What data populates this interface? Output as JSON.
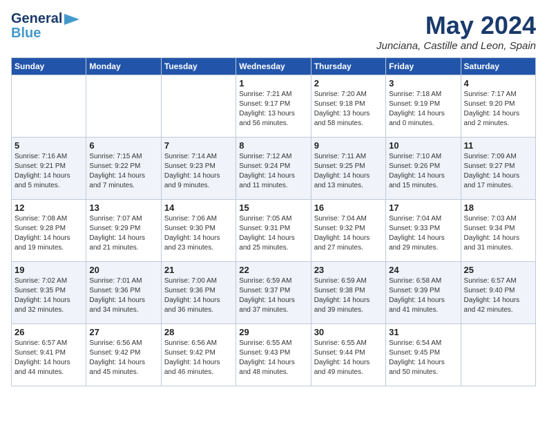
{
  "header": {
    "logo_general": "General",
    "logo_blue": "Blue",
    "month": "May 2024",
    "location": "Junciana, Castille and Leon, Spain"
  },
  "days_of_week": [
    "Sunday",
    "Monday",
    "Tuesday",
    "Wednesday",
    "Thursday",
    "Friday",
    "Saturday"
  ],
  "weeks": [
    {
      "days": [
        {
          "num": "",
          "info": ""
        },
        {
          "num": "",
          "info": ""
        },
        {
          "num": "",
          "info": ""
        },
        {
          "num": "1",
          "info": "Sunrise: 7:21 AM\nSunset: 9:17 PM\nDaylight: 13 hours\nand 56 minutes."
        },
        {
          "num": "2",
          "info": "Sunrise: 7:20 AM\nSunset: 9:18 PM\nDaylight: 13 hours\nand 58 minutes."
        },
        {
          "num": "3",
          "info": "Sunrise: 7:18 AM\nSunset: 9:19 PM\nDaylight: 14 hours\nand 0 minutes."
        },
        {
          "num": "4",
          "info": "Sunrise: 7:17 AM\nSunset: 9:20 PM\nDaylight: 14 hours\nand 2 minutes."
        }
      ]
    },
    {
      "days": [
        {
          "num": "5",
          "info": "Sunrise: 7:16 AM\nSunset: 9:21 PM\nDaylight: 14 hours\nand 5 minutes."
        },
        {
          "num": "6",
          "info": "Sunrise: 7:15 AM\nSunset: 9:22 PM\nDaylight: 14 hours\nand 7 minutes."
        },
        {
          "num": "7",
          "info": "Sunrise: 7:14 AM\nSunset: 9:23 PM\nDaylight: 14 hours\nand 9 minutes."
        },
        {
          "num": "8",
          "info": "Sunrise: 7:12 AM\nSunset: 9:24 PM\nDaylight: 14 hours\nand 11 minutes."
        },
        {
          "num": "9",
          "info": "Sunrise: 7:11 AM\nSunset: 9:25 PM\nDaylight: 14 hours\nand 13 minutes."
        },
        {
          "num": "10",
          "info": "Sunrise: 7:10 AM\nSunset: 9:26 PM\nDaylight: 14 hours\nand 15 minutes."
        },
        {
          "num": "11",
          "info": "Sunrise: 7:09 AM\nSunset: 9:27 PM\nDaylight: 14 hours\nand 17 minutes."
        }
      ]
    },
    {
      "days": [
        {
          "num": "12",
          "info": "Sunrise: 7:08 AM\nSunset: 9:28 PM\nDaylight: 14 hours\nand 19 minutes."
        },
        {
          "num": "13",
          "info": "Sunrise: 7:07 AM\nSunset: 9:29 PM\nDaylight: 14 hours\nand 21 minutes."
        },
        {
          "num": "14",
          "info": "Sunrise: 7:06 AM\nSunset: 9:30 PM\nDaylight: 14 hours\nand 23 minutes."
        },
        {
          "num": "15",
          "info": "Sunrise: 7:05 AM\nSunset: 9:31 PM\nDaylight: 14 hours\nand 25 minutes."
        },
        {
          "num": "16",
          "info": "Sunrise: 7:04 AM\nSunset: 9:32 PM\nDaylight: 14 hours\nand 27 minutes."
        },
        {
          "num": "17",
          "info": "Sunrise: 7:04 AM\nSunset: 9:33 PM\nDaylight: 14 hours\nand 29 minutes."
        },
        {
          "num": "18",
          "info": "Sunrise: 7:03 AM\nSunset: 9:34 PM\nDaylight: 14 hours\nand 31 minutes."
        }
      ]
    },
    {
      "days": [
        {
          "num": "19",
          "info": "Sunrise: 7:02 AM\nSunset: 9:35 PM\nDaylight: 14 hours\nand 32 minutes."
        },
        {
          "num": "20",
          "info": "Sunrise: 7:01 AM\nSunset: 9:36 PM\nDaylight: 14 hours\nand 34 minutes."
        },
        {
          "num": "21",
          "info": "Sunrise: 7:00 AM\nSunset: 9:36 PM\nDaylight: 14 hours\nand 36 minutes."
        },
        {
          "num": "22",
          "info": "Sunrise: 6:59 AM\nSunset: 9:37 PM\nDaylight: 14 hours\nand 37 minutes."
        },
        {
          "num": "23",
          "info": "Sunrise: 6:59 AM\nSunset: 9:38 PM\nDaylight: 14 hours\nand 39 minutes."
        },
        {
          "num": "24",
          "info": "Sunrise: 6:58 AM\nSunset: 9:39 PM\nDaylight: 14 hours\nand 41 minutes."
        },
        {
          "num": "25",
          "info": "Sunrise: 6:57 AM\nSunset: 9:40 PM\nDaylight: 14 hours\nand 42 minutes."
        }
      ]
    },
    {
      "days": [
        {
          "num": "26",
          "info": "Sunrise: 6:57 AM\nSunset: 9:41 PM\nDaylight: 14 hours\nand 44 minutes."
        },
        {
          "num": "27",
          "info": "Sunrise: 6:56 AM\nSunset: 9:42 PM\nDaylight: 14 hours\nand 45 minutes."
        },
        {
          "num": "28",
          "info": "Sunrise: 6:56 AM\nSunset: 9:42 PM\nDaylight: 14 hours\nand 46 minutes."
        },
        {
          "num": "29",
          "info": "Sunrise: 6:55 AM\nSunset: 9:43 PM\nDaylight: 14 hours\nand 48 minutes."
        },
        {
          "num": "30",
          "info": "Sunrise: 6:55 AM\nSunset: 9:44 PM\nDaylight: 14 hours\nand 49 minutes."
        },
        {
          "num": "31",
          "info": "Sunrise: 6:54 AM\nSunset: 9:45 PM\nDaylight: 14 hours\nand 50 minutes."
        },
        {
          "num": "",
          "info": ""
        }
      ]
    }
  ]
}
